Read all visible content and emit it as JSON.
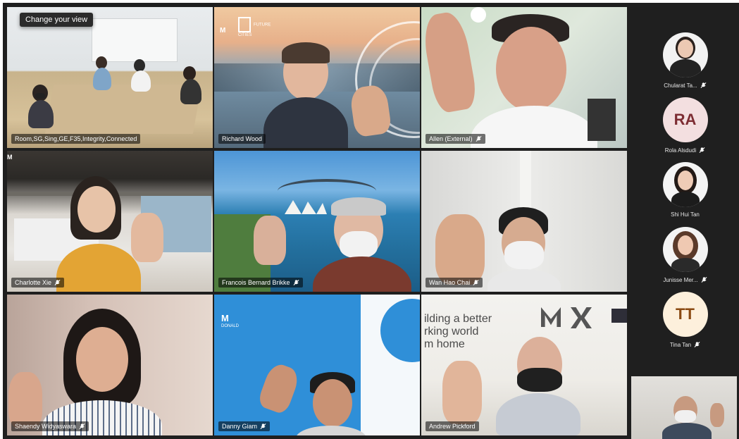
{
  "tooltip": "Change your view",
  "tiles": [
    {
      "name": "Room,SG,Sing,GE,F35,Integrity,Connected",
      "muted": false
    },
    {
      "name": "Richard Wood",
      "muted": false
    },
    {
      "name": "Allen (External)",
      "muted": true
    },
    {
      "name": "Charlotte Xie",
      "muted": true
    },
    {
      "name": "Francois Bernard Brikke",
      "muted": true
    },
    {
      "name": "Wan Hao Chai",
      "muted": true
    },
    {
      "name": "Shaendy Widyaswara",
      "muted": true
    },
    {
      "name": "Danny Giam",
      "muted": true
    },
    {
      "name": "Andrew Pickford",
      "muted": false
    }
  ],
  "background_text": {
    "futurecities": "FUTURE CITIES",
    "logo_m": "M",
    "logo_m2": "M",
    "donald": "DONALD",
    "building_line1": "ilding a better",
    "building_line2": "rking world",
    "building_line3": "m home"
  },
  "roster": [
    {
      "name": "Chularat Ta...",
      "initials": "",
      "muted": true
    },
    {
      "name": "Rola Alsdudi",
      "initials": "RA",
      "muted": true
    },
    {
      "name": "Shi Hui Tan",
      "initials": "",
      "muted": false
    },
    {
      "name": "Junisse Mer...",
      "initials": "",
      "muted": true
    },
    {
      "name": "Tina Tan",
      "initials": "TT",
      "muted": true
    }
  ],
  "colors": {
    "stage_bg": "#1f1f1f",
    "selected_outline": "#8b8cd6",
    "ra_avatar_bg": "#f3dfe0",
    "tt_avatar_bg": "#fdf0dc"
  }
}
